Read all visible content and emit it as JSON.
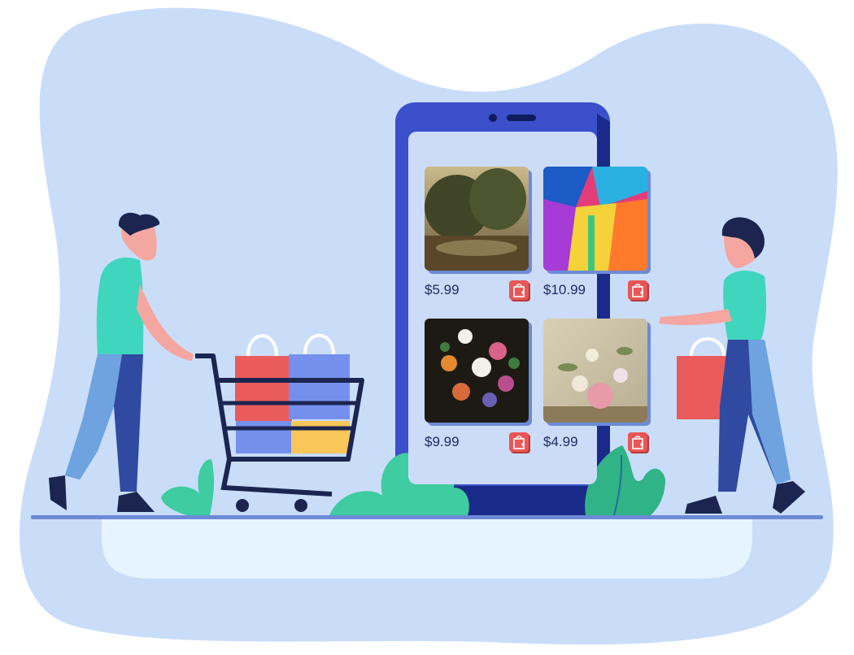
{
  "products": [
    {
      "price": "$5.99",
      "artwork": "forest-landscape-painting",
      "icon": "add-to-cart-bag-icon"
    },
    {
      "price": "$10.99",
      "artwork": "colorful-abstract-painting",
      "icon": "add-to-cart-bag-icon"
    },
    {
      "price": "$9.99",
      "artwork": "flower-bouquet-dark-painting",
      "icon": "add-to-cart-bag-icon"
    },
    {
      "price": "$4.99",
      "artwork": "rose-still-life-painting",
      "icon": "add-to-cart-bag-icon"
    }
  ],
  "colors": {
    "blob": "#c9ddf9",
    "phone_body": "#3a4fc9",
    "phone_screen": "#ccdcf8",
    "button": "#ea5656",
    "shirt": "#40d6be",
    "pants": "#2f4aa0",
    "bag_red": "#ea5b5b",
    "bag_blue": "#7590ec",
    "bag_yellow": "#f8c659",
    "plant": "#3fcca0"
  }
}
